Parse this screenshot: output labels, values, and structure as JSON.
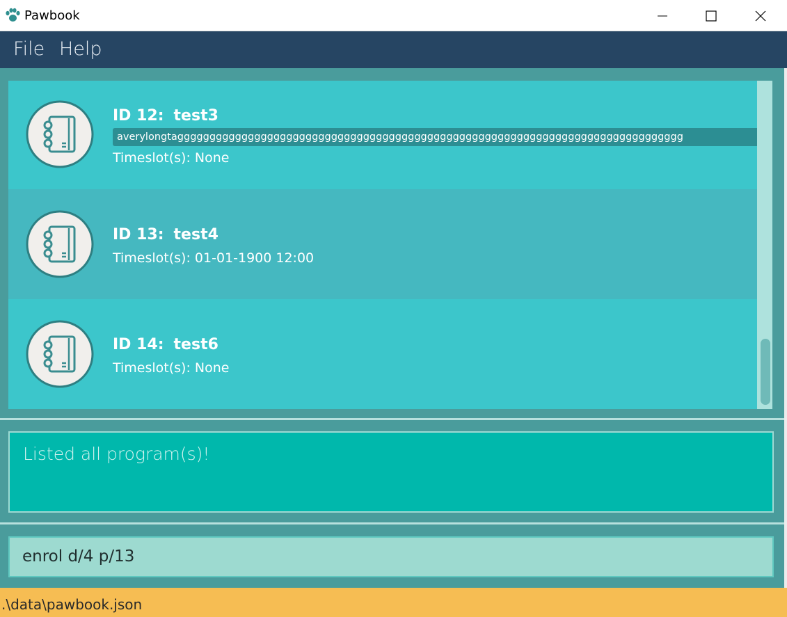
{
  "window": {
    "title": "Pawbook",
    "app_icon": "paw-icon",
    "controls": [
      "minimize-icon",
      "maximize-icon",
      "close-icon"
    ]
  },
  "menu": {
    "file_label": "File",
    "help_label": "Help"
  },
  "programs": [
    {
      "id_label": "ID 12:",
      "name": "test3",
      "tag": "averylongtaggggggggggggggggggggggggggggggggggggggggggggggggggggggggggggggggggggggggggggggg",
      "timeslot": "Timeslot(s): None",
      "icon": "notebook-icon"
    },
    {
      "id_label": "ID 13:",
      "name": "test4",
      "timeslot": "Timeslot(s): 01-01-1900 12:00",
      "icon": "notebook-icon"
    },
    {
      "id_label": "ID 14:",
      "name": "test6",
      "timeslot": "Timeslot(s): None",
      "icon": "notebook-icon"
    }
  ],
  "result": {
    "message": "Listed all program(s)!"
  },
  "command": {
    "value": "enrol d/4 p/13"
  },
  "status": {
    "file_path": ".\\data\\pawbook.json"
  },
  "colors": {
    "menubar": "#264563",
    "list_background": "#3cc6cb",
    "list_alt_row": "#45b8c0",
    "result_box": "#00b8ac",
    "command_box": "#9ddad0",
    "statusbar": "#f6bd53"
  }
}
